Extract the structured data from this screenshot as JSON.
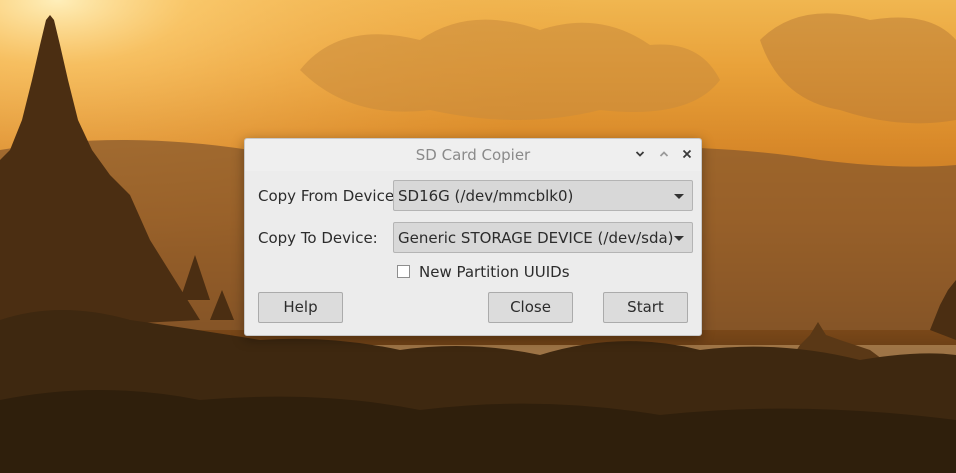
{
  "dialog": {
    "title": "SD Card Copier",
    "copy_from_label": "Copy From Device:",
    "copy_from_value": "SD16G  (/dev/mmcblk0)",
    "copy_to_label": "Copy To Device:",
    "copy_to_value": "Generic STORAGE DEVICE  (/dev/sda)",
    "new_uuids_label": "New Partition UUIDs",
    "new_uuids_checked": false,
    "help_label": "Help",
    "close_label": "Close",
    "start_label": "Start"
  },
  "titlebar_icons": [
    "chevron-down-icon",
    "chevron-up-icon",
    "close-icon"
  ],
  "colors": {
    "dialog_bg": "#ececec",
    "title_text": "#8a8a8a",
    "button_bg": "#dcdcdc",
    "combo_bg": "#d8d8d8",
    "sky_glow": "#f0b650",
    "silhouette": "#3a2610"
  }
}
